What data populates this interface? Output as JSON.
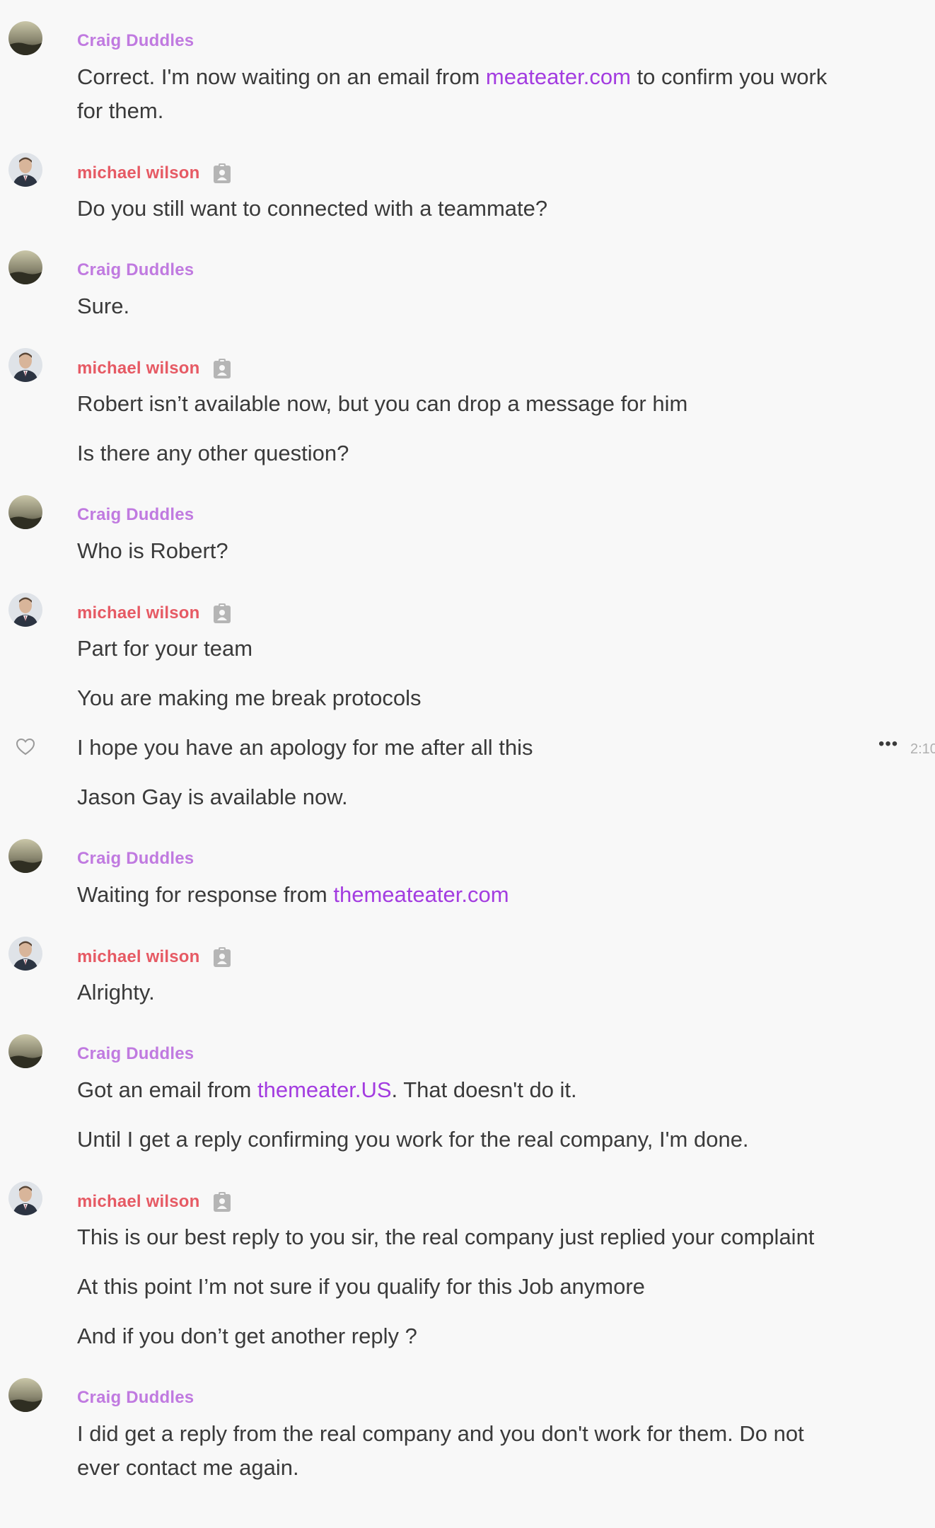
{
  "users": {
    "craig": {
      "name": "Craig Duddles",
      "color": "#c07ae0"
    },
    "michael": {
      "name": "michael wilson",
      "color": "#e65a64",
      "badge_icon": "id-badge-icon"
    }
  },
  "colors": {
    "link": "#a33ce0",
    "text": "#3a3a3a",
    "background": "#f8f8f8"
  },
  "messages": [
    {
      "sender": "Craig Duddles",
      "lines": [
        {
          "before": "Correct. I'm now waiting on an email from ",
          "link": "meateater.com",
          "after": " to confirm you work"
        },
        {
          "text": "for them."
        }
      ]
    },
    {
      "sender": "michael wilson",
      "lines": [
        {
          "text": "Do you still want to connected with a teammate?"
        }
      ]
    },
    {
      "sender": "Craig Duddles",
      "lines": [
        {
          "text": "Sure."
        }
      ]
    },
    {
      "sender": "michael wilson",
      "lines": [
        {
          "text": "Robert isn’t available now, but you can drop a message for him"
        },
        {
          "text": "Is there any other question?"
        }
      ]
    },
    {
      "sender": "Craig Duddles",
      "lines": [
        {
          "text": "Who is Robert?"
        }
      ]
    },
    {
      "sender": "michael wilson",
      "lines": [
        {
          "text": "Part for your team"
        },
        {
          "text": "You are making me break protocols"
        },
        {
          "text": "I hope you have an apology for me after all this",
          "hovered": true,
          "react_icon": "heart-icon",
          "more_icon": "more-horizontal-icon",
          "timestamp": "2:10"
        },
        {
          "text": "Jason Gay is available now."
        }
      ]
    },
    {
      "sender": "Craig Duddles",
      "lines": [
        {
          "before": "Waiting for response from ",
          "link": "themeateater.com",
          "after": ""
        }
      ]
    },
    {
      "sender": "michael wilson",
      "lines": [
        {
          "text": "Alrighty."
        }
      ]
    },
    {
      "sender": "Craig Duddles",
      "lines": [
        {
          "before": "Got an email from ",
          "link": "themeater.US",
          "after": ". That doesn't do it."
        },
        {
          "text": "Until I get a reply confirming you work for the real company, I'm done."
        }
      ]
    },
    {
      "sender": "michael wilson",
      "lines": [
        {
          "text": "This is our best reply to you sir, the real company just replied your complaint"
        },
        {
          "text": "At this point I’m not sure if you qualify for this Job anymore"
        },
        {
          "text": "And if you don’t get another reply ?"
        }
      ]
    },
    {
      "sender": "Craig Duddles",
      "lines": [
        {
          "text": "I did get a reply from the real company and you don't work for them. Do not"
        },
        {
          "text": "ever contact me again."
        }
      ]
    }
  ]
}
